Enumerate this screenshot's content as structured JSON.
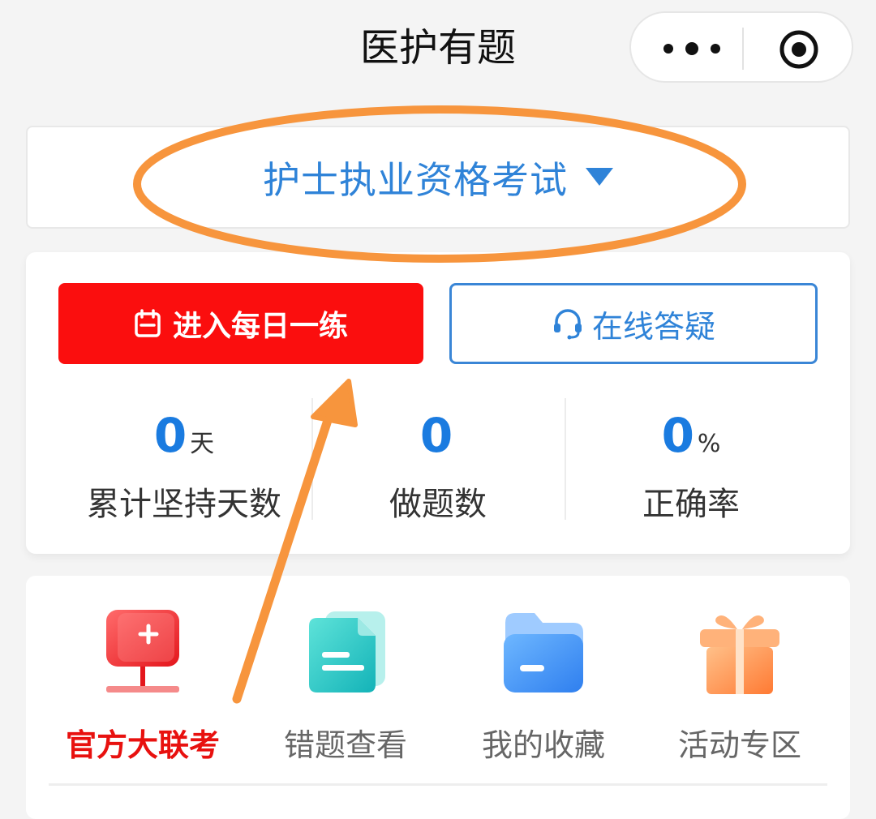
{
  "header": {
    "title": "医护有题",
    "more_icon": "more-dots-icon",
    "close_icon": "target-icon"
  },
  "exam_selector": {
    "name": "护士执业资格考试",
    "caret_icon": "caret-down-icon"
  },
  "actions": {
    "daily_practice": "进入每日一练",
    "online_qa": "在线答疑"
  },
  "stats": [
    {
      "value": "0",
      "unit": "天",
      "label": "累计坚持天数"
    },
    {
      "value": "0",
      "unit": "",
      "label": "做题数"
    },
    {
      "value": "0",
      "unit": "%",
      "label": "正确率"
    }
  ],
  "menu": [
    {
      "label": "官方大联考",
      "icon": "exam-monitor-icon",
      "active": true
    },
    {
      "label": "错题查看",
      "icon": "document-icon",
      "active": false
    },
    {
      "label": "我的收藏",
      "icon": "folder-icon",
      "active": false
    },
    {
      "label": "活动专区",
      "icon": "gift-icon",
      "active": false
    }
  ],
  "colors": {
    "primary_red": "#fb0e0e",
    "primary_blue": "#2f83d8",
    "annotation_orange": "#f7953d"
  }
}
